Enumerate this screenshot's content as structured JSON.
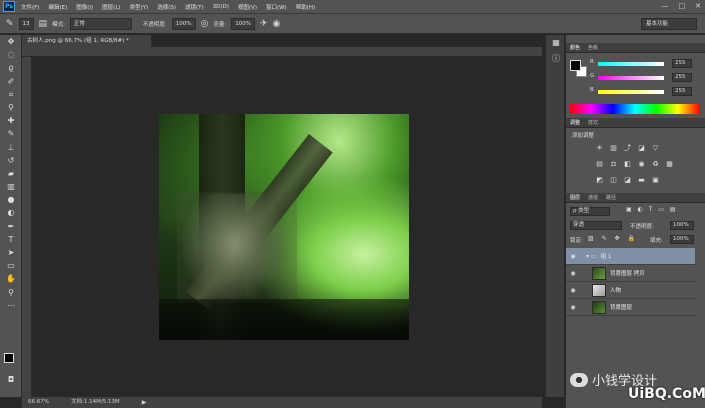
{
  "menu": {
    "logo": "Ps",
    "items": [
      "文件(F)",
      "编辑(E)",
      "图像(I)",
      "图层(L)",
      "类型(Y)",
      "选择(S)",
      "滤镜(T)",
      "3D(D)",
      "视图(V)",
      "窗口(W)",
      "帮助(H)"
    ],
    "window_controls": [
      "—",
      "□",
      "✕"
    ]
  },
  "options": {
    "brush_size": "13",
    "mode_label": "模式:",
    "mode_value": "正常",
    "opacity_label": "不透明度:",
    "opacity_value": "100%",
    "flow_label": "流量:",
    "flow_value": "100%",
    "workspace": "基本功能"
  },
  "document": {
    "tab_title": "古树人.png @ 66.7% (组 1, RGB/8#) *",
    "zoom": "66.67%",
    "doc_info": "文档:1.14M/5.13M"
  },
  "color_panel": {
    "tabs": [
      "颜色",
      "色板"
    ],
    "channels": [
      {
        "label": "R",
        "value": "255"
      },
      {
        "label": "G",
        "value": "255"
      },
      {
        "label": "B",
        "value": "255"
      }
    ],
    "colors": {
      "r_track": "#ff3030",
      "g_track": "#d040d0",
      "b_track": "#e0e040"
    }
  },
  "adjust_panel": {
    "tabs": [
      "调整",
      "样式"
    ],
    "title": "添加调整"
  },
  "layers_panel": {
    "tabs": [
      "图层",
      "通道",
      "路径"
    ],
    "filter_label": "ρ 类型",
    "blend_mode": "穿透",
    "opacity_label": "不透明度:",
    "opacity_value": "100%",
    "lock_label": "锁定:",
    "fill_label": "填充:",
    "fill_value": "100%",
    "layers": [
      {
        "name": "组 1",
        "type": "group",
        "selected": true
      },
      {
        "name": "背景图层 拷贝",
        "type": "layer",
        "selected": false
      },
      {
        "name": "人物",
        "type": "layer",
        "selected": false
      },
      {
        "name": "背景图层",
        "type": "layer",
        "selected": false
      }
    ]
  },
  "watermark": {
    "line1": "小钱学设计",
    "line2": "UiBQ.CoM"
  }
}
